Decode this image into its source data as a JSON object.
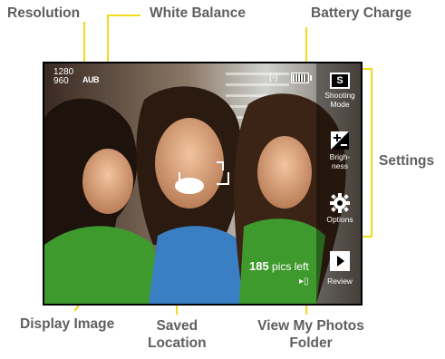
{
  "callouts": {
    "resolution": "Resolution",
    "white_balance": "White Balance",
    "battery": "Battery Charge",
    "settings": "Settings",
    "display_image": "Display Image",
    "saved_location_line1": "Saved",
    "saved_location_line2": "Location",
    "view_photos_line1": "View My Photos",
    "view_photos_line2": "Folder"
  },
  "screen": {
    "resolution_w": "1280",
    "resolution_h": "960",
    "white_balance": "AUB",
    "self_timer": "[◦]",
    "pics_count": "185",
    "pics_suffix": "pics left"
  },
  "settings": {
    "shooting": {
      "glyph": "S",
      "label_1": "Shooting",
      "label_2": "Mode"
    },
    "brightness": {
      "label_1": "Brigh-",
      "label_2": "ness"
    },
    "options": {
      "label": "Options"
    },
    "review": {
      "label": "Review"
    }
  },
  "colors": {
    "leader": "#f1da1a",
    "callout_text": "#5f5f5f",
    "shirt": "#3f9a2e"
  },
  "icons": [
    "battery-icon",
    "self-timer-icon",
    "shooting-mode-icon",
    "brightness-icon",
    "options-gear-icon",
    "review-play-icon",
    "location-icon"
  ]
}
